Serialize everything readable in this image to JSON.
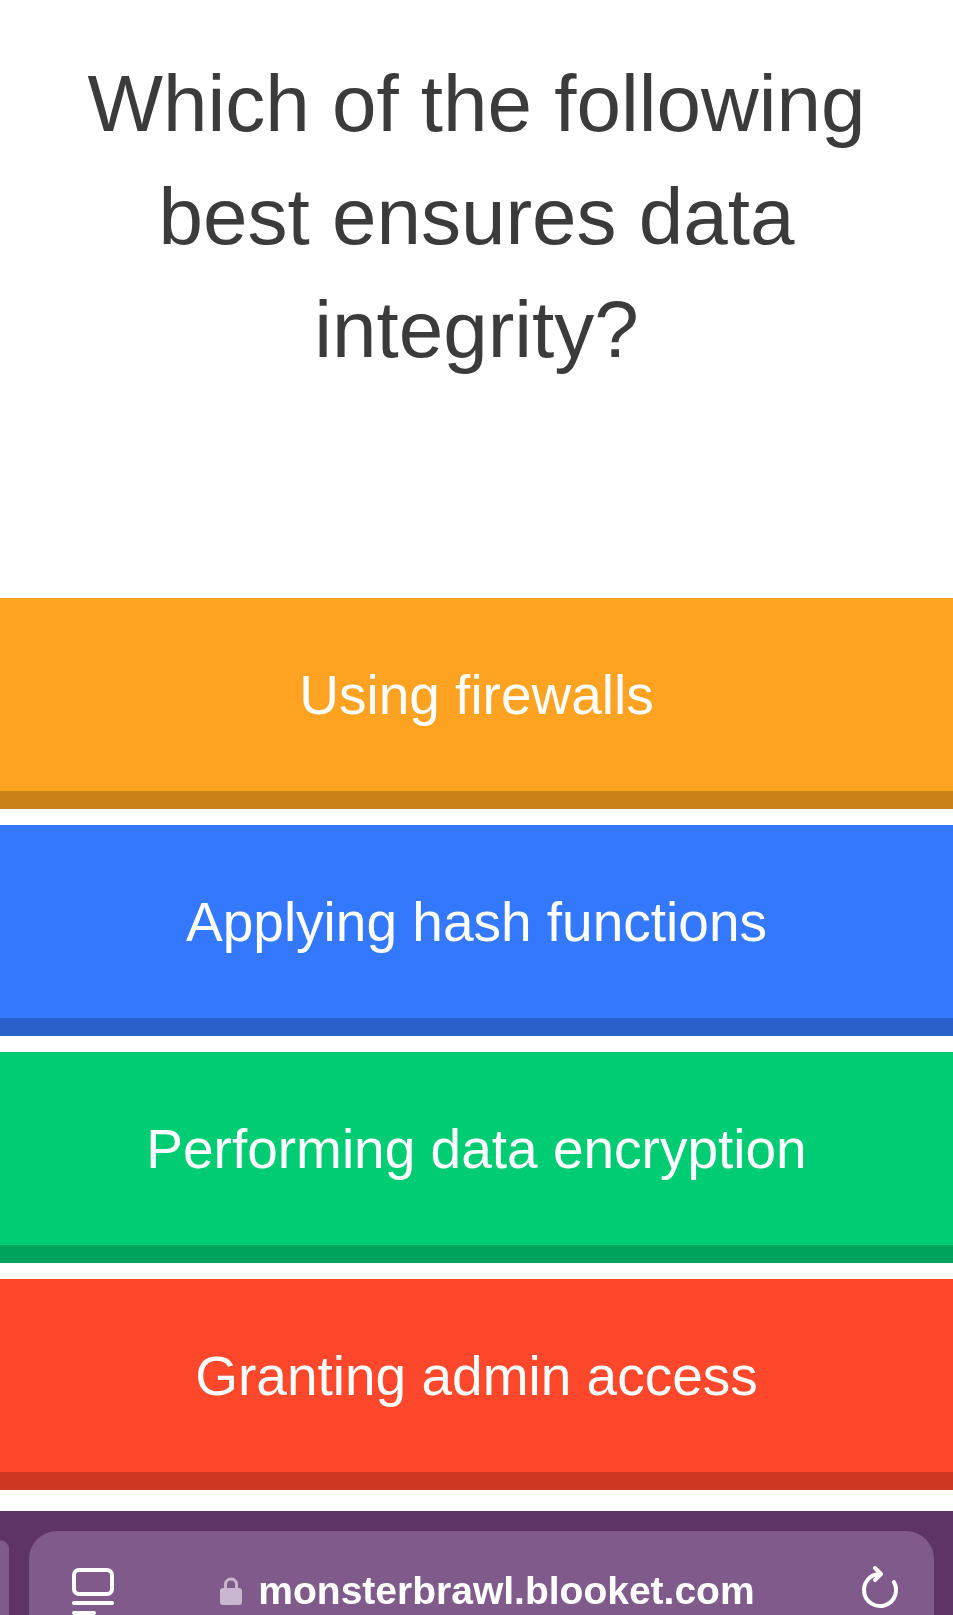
{
  "question": "Which of the following best ensures data integrity?",
  "answers": [
    {
      "text": "Using firewalls",
      "color": "#fea221"
    },
    {
      "text": "Applying hash functions",
      "color": "#3478fd"
    },
    {
      "text": "Performing data encryption",
      "color": "#00cc74"
    },
    {
      "text": "Granting admin access",
      "color": "#ff482b"
    }
  ],
  "browser_bar": {
    "url": "monsterbrawl.blooket.com"
  }
}
